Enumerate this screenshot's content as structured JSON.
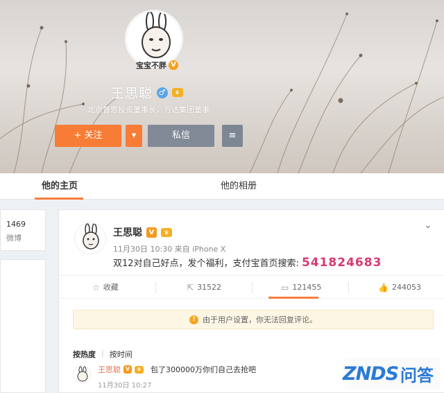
{
  "cover": {
    "avatar_name": "宝宝不胖",
    "profile_name": "王思聪",
    "bio": "北京普思投资董事长，万达集团董事",
    "follow_label": "+ 关注",
    "message_label": "私信"
  },
  "tabs": {
    "home": "他的主页",
    "photos": "他的相册"
  },
  "sidebar": {
    "count": "1469",
    "count_label": "微博"
  },
  "post": {
    "author": "王思聪",
    "meta": "11月30日 10:30 来自 iPhone X",
    "text": "双12对自己好点，发个福利，支付宝首页搜索:",
    "code": "541824683",
    "actions": {
      "favorite": "收藏",
      "repost": "31522",
      "comment": "121455",
      "like": "244053"
    },
    "notice": "由于用户设置，你无法回复评论。",
    "sort": {
      "hot": "按热度",
      "time": "按时间"
    },
    "comment": {
      "author": "王思聪",
      "text": "包了300000万你们自己去抢吧",
      "time": "11月30日 10:27"
    }
  },
  "watermark": {
    "brand": "ZNDS",
    "cn": "问答"
  },
  "colors": {
    "accent": "#fa7d3c",
    "follow": "#f77c35",
    "code": "#d83a6f",
    "vip": "#f59a1c"
  }
}
